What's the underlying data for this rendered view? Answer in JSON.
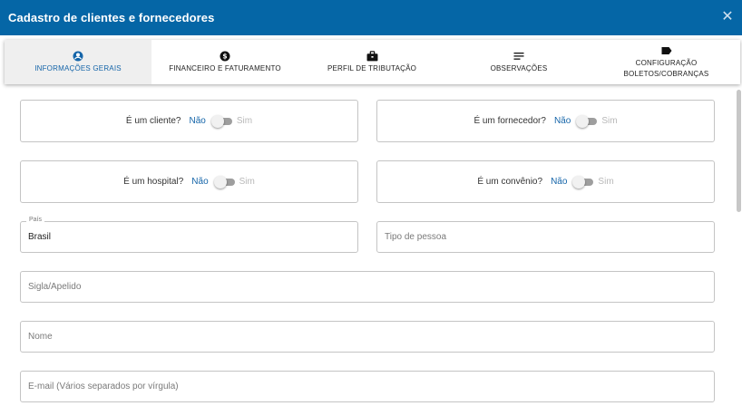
{
  "window": {
    "title": "Cadastro de clientes e fornecedores",
    "close_glyph": "✕"
  },
  "tabs": [
    {
      "label": "INFORMAÇÕES GERAIS",
      "icon": "account-circle-icon",
      "active": true
    },
    {
      "label": "FINANCEIRO E FATURAMENTO",
      "icon": "dollar-circle-icon",
      "active": false
    },
    {
      "label": "PERFIL DE TRIBUTAÇÃO",
      "icon": "briefcase-icon",
      "active": false
    },
    {
      "label": "OBSERVAÇÕES",
      "icon": "notes-icon",
      "active": false
    },
    {
      "label_line1": "CONFIGURAÇÃO",
      "label_line2": "BOLETOS/COBRANÇAS",
      "icon": "label-tag-icon",
      "active": false
    }
  ],
  "toggles": {
    "cliente": {
      "question": "É um cliente?",
      "no": "Não",
      "yes": "Sim",
      "value": "Não"
    },
    "fornecedor": {
      "question": "É um fornecedor?",
      "no": "Não",
      "yes": "Sim",
      "value": "Não"
    },
    "hospital": {
      "question": "É um hospital?",
      "no": "Não",
      "yes": "Sim",
      "value": "Não"
    },
    "convenio": {
      "question": "É um convênio?",
      "no": "Não",
      "yes": "Sim",
      "value": "Não"
    }
  },
  "fields": {
    "pais": {
      "label": "País",
      "value": "Brasil"
    },
    "tipo_pessoa": {
      "placeholder": "Tipo de pessoa"
    },
    "sigla": {
      "placeholder": "Sigla/Apelido"
    },
    "nome": {
      "placeholder": "Nome"
    },
    "email": {
      "placeholder": "E-mail (Vários separados por vírgula)"
    }
  },
  "colors": {
    "header": "#0566a6",
    "accent": "#1565a9"
  }
}
